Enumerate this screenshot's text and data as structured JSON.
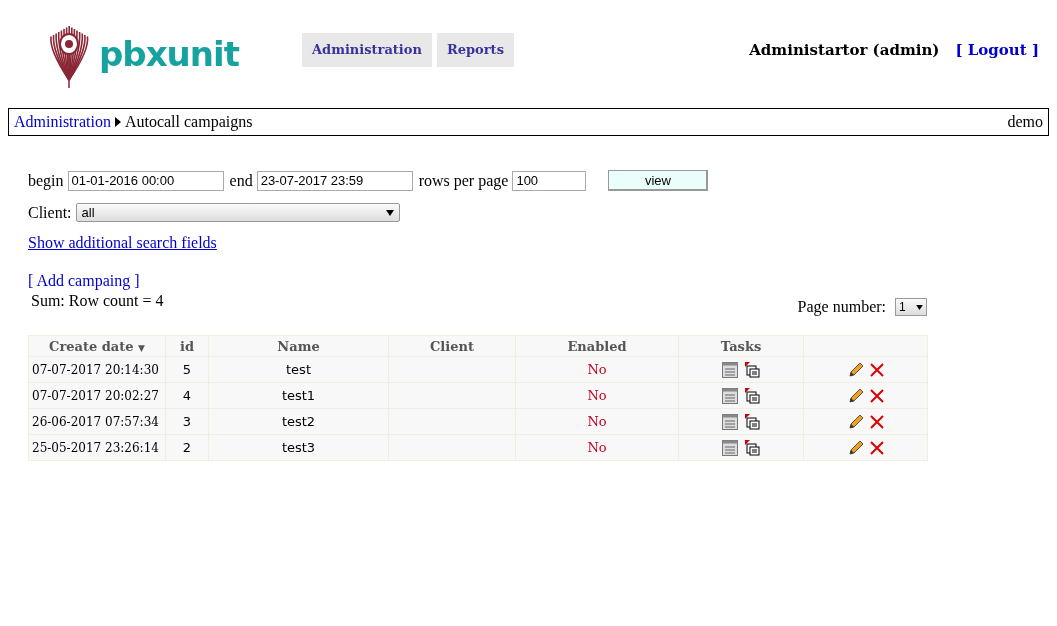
{
  "logo": {
    "text": "pbxunit"
  },
  "nav": [
    {
      "label": "Administration",
      "selected": false
    },
    {
      "label": "Reports",
      "selected": false
    }
  ],
  "user": {
    "name": "Administartor (admin)",
    "logout": "[ Logout ]"
  },
  "breadcrumb": {
    "parent": "Administration",
    "current": "Autocall campaigns",
    "right": "demo"
  },
  "filters": {
    "begin_label": "begin",
    "begin": "01-01-2016 00:00",
    "end_label": "end",
    "end": "23-07-2017 23:59",
    "rows_label": "rows per page",
    "rows": "100",
    "view_button": "view",
    "client_label": "Client:",
    "client": "all",
    "more_link": "Show additional search fields"
  },
  "add_link": "[ Add campaing ]",
  "summary": "Sum: Row count = 4",
  "pager": {
    "label": "Page number:",
    "value": "1"
  },
  "table": {
    "columns": [
      {
        "label": "Create date",
        "sort": "▼"
      },
      {
        "label": "id"
      },
      {
        "label": "Name"
      },
      {
        "label": "Client"
      },
      {
        "label": "Enabled"
      },
      {
        "label": "Tasks"
      }
    ],
    "rows": [
      {
        "date": "07-07-2017 20:14:30",
        "id": "5",
        "name": "test",
        "enabled": "No"
      },
      {
        "date": "07-07-2017 20:02:27",
        "id": "4",
        "name": "test1",
        "enabled": "No"
      },
      {
        "date": "26-06-2017 07:57:34",
        "id": "3",
        "name": "test2",
        "enabled": "No"
      },
      {
        "date": "25-05-2017 23:26:14",
        "id": "2",
        "name": "test3",
        "enabled": "No"
      }
    ]
  }
}
